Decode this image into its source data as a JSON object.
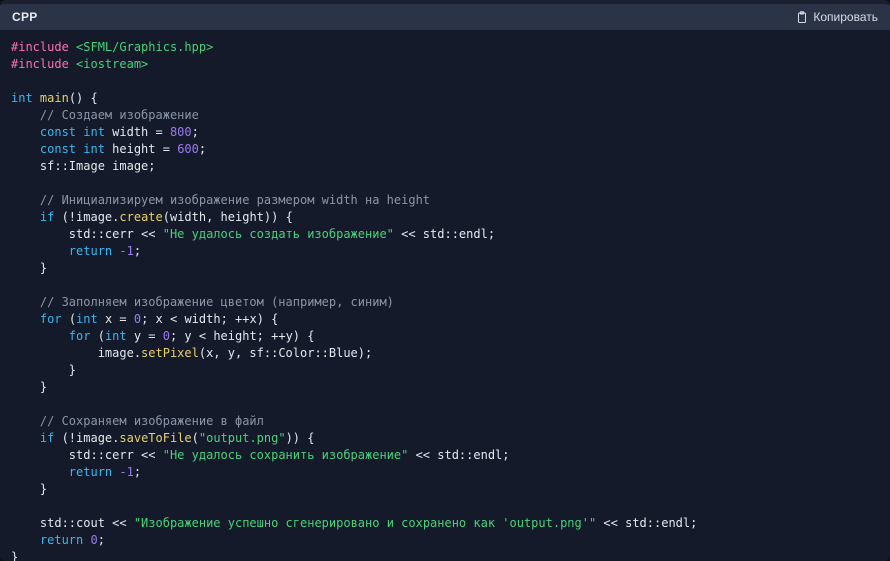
{
  "header": {
    "language_label": "CPP",
    "copy_label": "Копировать",
    "copy_icon": "clipboard-icon"
  },
  "colors": {
    "page_background": "#0d1117",
    "header_background": "#2b3347",
    "code_background": "#141a29",
    "top_strip": "#1b2030",
    "text_default": "#e3e8f0",
    "preprocessor": "#ff6fae",
    "string": "#49d17a",
    "keyword": "#39b7f0",
    "function": "#e8d06a",
    "number": "#9b7bf0",
    "comment": "#8b95a8",
    "header_text": "#e6ebf2",
    "copy_text": "#d7dde7"
  },
  "code": {
    "language": "cpp",
    "lines": [
      [
        {
          "t": "#include ",
          "c": "pre"
        },
        {
          "t": "<SFML/Graphics.hpp>",
          "c": "str"
        }
      ],
      [
        {
          "t": "#include ",
          "c": "pre"
        },
        {
          "t": "<iostream>",
          "c": "str"
        }
      ],
      [],
      [
        {
          "t": "int ",
          "c": "key"
        },
        {
          "t": "main",
          "c": "fn"
        },
        {
          "t": "() {",
          "c": "pln"
        }
      ],
      [
        {
          "t": "    // Создаем изображение",
          "c": "com"
        }
      ],
      [
        {
          "t": "    ",
          "c": "pln"
        },
        {
          "t": "const int ",
          "c": "key"
        },
        {
          "t": "width = ",
          "c": "pln"
        },
        {
          "t": "800",
          "c": "num"
        },
        {
          "t": ";",
          "c": "pln"
        }
      ],
      [
        {
          "t": "    ",
          "c": "pln"
        },
        {
          "t": "const int ",
          "c": "key"
        },
        {
          "t": "height = ",
          "c": "pln"
        },
        {
          "t": "600",
          "c": "num"
        },
        {
          "t": ";",
          "c": "pln"
        }
      ],
      [
        {
          "t": "    sf::Image image;",
          "c": "pln"
        }
      ],
      [],
      [
        {
          "t": "    // Инициализируем изображение размером width на height",
          "c": "com"
        }
      ],
      [
        {
          "t": "    ",
          "c": "pln"
        },
        {
          "t": "if",
          "c": "key"
        },
        {
          "t": " (!image.",
          "c": "pln"
        },
        {
          "t": "create",
          "c": "fn"
        },
        {
          "t": "(width, height)) {",
          "c": "pln"
        }
      ],
      [
        {
          "t": "        std::cerr << ",
          "c": "pln"
        },
        {
          "t": "\"Не удалось создать изображение\"",
          "c": "str"
        },
        {
          "t": " << std::endl;",
          "c": "pln"
        }
      ],
      [
        {
          "t": "        ",
          "c": "pln"
        },
        {
          "t": "return ",
          "c": "key"
        },
        {
          "t": "-1",
          "c": "num"
        },
        {
          "t": ";",
          "c": "pln"
        }
      ],
      [
        {
          "t": "    }",
          "c": "pln"
        }
      ],
      [],
      [
        {
          "t": "    // Заполняем изображение цветом (например, синим)",
          "c": "com"
        }
      ],
      [
        {
          "t": "    ",
          "c": "pln"
        },
        {
          "t": "for",
          "c": "key"
        },
        {
          "t": " (",
          "c": "pln"
        },
        {
          "t": "int ",
          "c": "key"
        },
        {
          "t": "x = ",
          "c": "pln"
        },
        {
          "t": "0",
          "c": "num"
        },
        {
          "t": "; x < width; ++x) {",
          "c": "pln"
        }
      ],
      [
        {
          "t": "        ",
          "c": "pln"
        },
        {
          "t": "for",
          "c": "key"
        },
        {
          "t": " (",
          "c": "pln"
        },
        {
          "t": "int ",
          "c": "key"
        },
        {
          "t": "y = ",
          "c": "pln"
        },
        {
          "t": "0",
          "c": "num"
        },
        {
          "t": "; y < height; ++y) {",
          "c": "pln"
        }
      ],
      [
        {
          "t": "            image.",
          "c": "pln"
        },
        {
          "t": "setPixel",
          "c": "fn"
        },
        {
          "t": "(x, y, sf::Color::Blue);",
          "c": "pln"
        }
      ],
      [
        {
          "t": "        }",
          "c": "pln"
        }
      ],
      [
        {
          "t": "    }",
          "c": "pln"
        }
      ],
      [],
      [
        {
          "t": "    // Сохраняем изображение в файл",
          "c": "com"
        }
      ],
      [
        {
          "t": "    ",
          "c": "pln"
        },
        {
          "t": "if",
          "c": "key"
        },
        {
          "t": " (!image.",
          "c": "pln"
        },
        {
          "t": "saveToFile",
          "c": "fn"
        },
        {
          "t": "(",
          "c": "pln"
        },
        {
          "t": "\"output.png\"",
          "c": "str"
        },
        {
          "t": ")) {",
          "c": "pln"
        }
      ],
      [
        {
          "t": "        std::cerr << ",
          "c": "pln"
        },
        {
          "t": "\"Не удалось сохранить изображение\"",
          "c": "str"
        },
        {
          "t": " << std::endl;",
          "c": "pln"
        }
      ],
      [
        {
          "t": "        ",
          "c": "pln"
        },
        {
          "t": "return ",
          "c": "key"
        },
        {
          "t": "-1",
          "c": "num"
        },
        {
          "t": ";",
          "c": "pln"
        }
      ],
      [
        {
          "t": "    }",
          "c": "pln"
        }
      ],
      [],
      [
        {
          "t": "    std::cout << ",
          "c": "pln"
        },
        {
          "t": "\"Изображение успешно сгенерировано и сохранено как 'output.png'\"",
          "c": "str"
        },
        {
          "t": " << std::endl;",
          "c": "pln"
        }
      ],
      [
        {
          "t": "    ",
          "c": "pln"
        },
        {
          "t": "return ",
          "c": "key"
        },
        {
          "t": "0",
          "c": "num"
        },
        {
          "t": ";",
          "c": "pln"
        }
      ],
      [
        {
          "t": "}",
          "c": "pln"
        }
      ]
    ]
  }
}
